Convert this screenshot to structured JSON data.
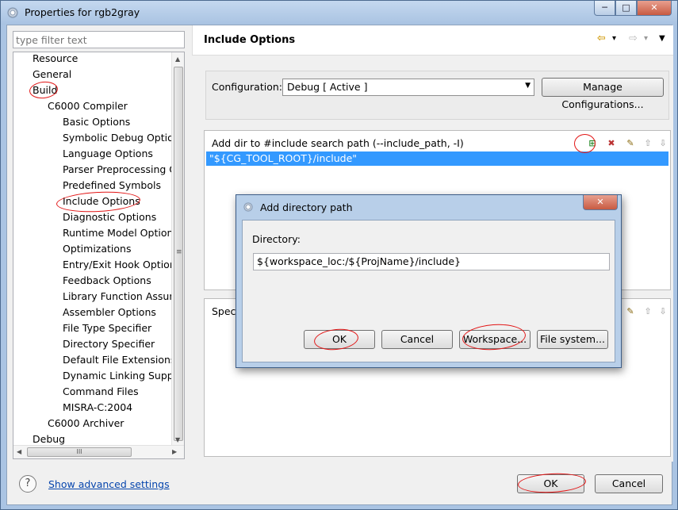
{
  "window": {
    "title": "Properties for rgb2gray",
    "min_label": "─",
    "max_label": "□",
    "close_label": "✕"
  },
  "sidebar": {
    "filter_placeholder": "type filter text",
    "items": [
      {
        "label": "Resource"
      },
      {
        "label": "General"
      },
      {
        "label": "Build"
      },
      {
        "label": "C6000 Compiler"
      },
      {
        "label": "Basic Options"
      },
      {
        "label": "Symbolic Debug Options"
      },
      {
        "label": "Language Options"
      },
      {
        "label": "Parser Preprocessing Options"
      },
      {
        "label": "Predefined Symbols"
      },
      {
        "label": "Include Options"
      },
      {
        "label": "Diagnostic Options"
      },
      {
        "label": "Runtime Model Options"
      },
      {
        "label": "Optimizations"
      },
      {
        "label": "Entry/Exit Hook Options"
      },
      {
        "label": "Feedback Options"
      },
      {
        "label": "Library Function Assumptions"
      },
      {
        "label": "Assembler Options"
      },
      {
        "label": "File Type Specifier"
      },
      {
        "label": "Directory Specifier"
      },
      {
        "label": "Default File Extensions"
      },
      {
        "label": "Dynamic Linking Support"
      },
      {
        "label": "Command Files"
      },
      {
        "label": "MISRA-C:2004"
      },
      {
        "label": "C6000 Archiver"
      },
      {
        "label": "Debug"
      }
    ],
    "scroll_grip": "≡",
    "hscroll_grip": "III"
  },
  "main": {
    "page_title": "Include Options",
    "nav_back": "⇦",
    "nav_back_menu": "▾",
    "nav_forward": "⇨",
    "nav_forward_menu": "▾",
    "nav_menu": "▼",
    "configuration_label": "Configuration:",
    "configuration_value": "Debug  [ Active ]",
    "manage_configurations": "Manage Configurations...",
    "include_path_label": "Add dir to #include search path (--include_path, -I)",
    "include_paths": [
      "\"${CG_TOOL_ROOT}/include\""
    ],
    "specify_label": "Speci"
  },
  "dialog": {
    "title": "Add directory path",
    "close_label": "✕",
    "directory_label": "Directory:",
    "directory_value": "${workspace_loc:/${ProjName}/include}",
    "ok": "OK",
    "cancel": "Cancel",
    "workspace": "Workspace...",
    "file_system": "File system..."
  },
  "footer": {
    "help_label": "?",
    "show_advanced": "Show advanced settings",
    "ok": "OK",
    "cancel": "Cancel"
  },
  "colors": {
    "selection": "#3399ff",
    "annotation": "#e21515",
    "link": "#0645ad"
  }
}
